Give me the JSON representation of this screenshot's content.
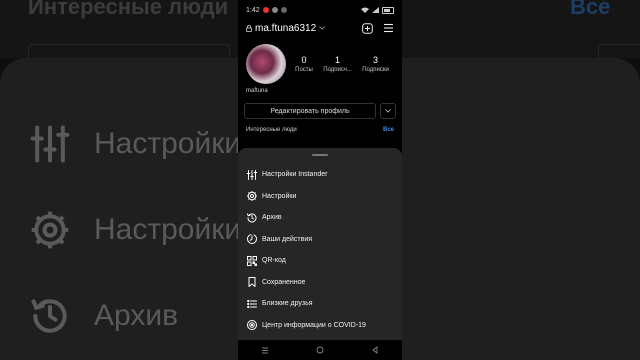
{
  "background": {
    "title": "Интересные люди",
    "all_label": "Все",
    "items": [
      {
        "label": "Настройки",
        "icon": "sliders-icon"
      },
      {
        "label": "Настройки",
        "icon": "gear-icon"
      },
      {
        "label": "Архив",
        "icon": "history-icon"
      }
    ]
  },
  "status_bar": {
    "time": "1:42"
  },
  "header": {
    "username": "ma.ftuna6312"
  },
  "profile": {
    "stats": [
      {
        "number": "0",
        "label": "Посты"
      },
      {
        "number": "1",
        "label": "Подписч..."
      },
      {
        "number": "3",
        "label": "Подписки"
      }
    ],
    "name": "maftuna",
    "edit_label": "Редактировать профиль"
  },
  "people": {
    "title": "Интересные люди",
    "all": "Все"
  },
  "sheet": {
    "items": [
      {
        "label": "Настройки Instander",
        "icon": "sliders-icon"
      },
      {
        "label": "Настройки",
        "icon": "gear-icon"
      },
      {
        "label": "Архив",
        "icon": "history-icon"
      },
      {
        "label": "Ваши действия",
        "icon": "activity-icon"
      },
      {
        "label": "QR-код",
        "icon": "qr-code-icon"
      },
      {
        "label": "Сохраненное",
        "icon": "bookmark-icon"
      },
      {
        "label": "Близкие друзья",
        "icon": "close-friends-icon"
      },
      {
        "label": "Центр информации о COVID-19",
        "icon": "covid-info-icon"
      }
    ]
  },
  "colors": {
    "accent": "#3d8be6",
    "sheet_bg": "#262626",
    "background": "#000000"
  }
}
